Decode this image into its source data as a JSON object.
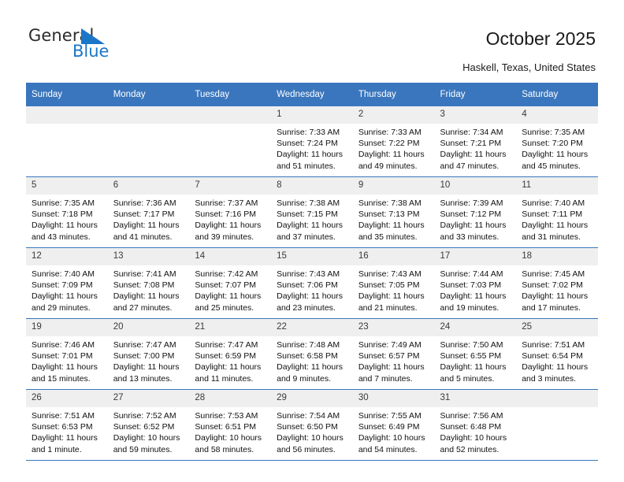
{
  "brand": {
    "name_top": "General",
    "name_bottom": "Blue",
    "triangle_color": "#1b76c8"
  },
  "header": {
    "title": "October 2025",
    "location": "Haskell, Texas, United States"
  },
  "theme": {
    "header_blue": "#3a76bd",
    "daynum_bg": "#efefef",
    "text": "#111111"
  },
  "calendar": {
    "weekday_headers": [
      "Sunday",
      "Monday",
      "Tuesday",
      "Wednesday",
      "Thursday",
      "Friday",
      "Saturday"
    ],
    "weeks": [
      [
        {
          "day": "",
          "lines": []
        },
        {
          "day": "",
          "lines": []
        },
        {
          "day": "",
          "lines": []
        },
        {
          "day": "1",
          "lines": [
            "Sunrise: 7:33 AM",
            "Sunset: 7:24 PM",
            "Daylight: 11 hours",
            "and 51 minutes."
          ]
        },
        {
          "day": "2",
          "lines": [
            "Sunrise: 7:33 AM",
            "Sunset: 7:22 PM",
            "Daylight: 11 hours",
            "and 49 minutes."
          ]
        },
        {
          "day": "3",
          "lines": [
            "Sunrise: 7:34 AM",
            "Sunset: 7:21 PM",
            "Daylight: 11 hours",
            "and 47 minutes."
          ]
        },
        {
          "day": "4",
          "lines": [
            "Sunrise: 7:35 AM",
            "Sunset: 7:20 PM",
            "Daylight: 11 hours",
            "and 45 minutes."
          ]
        }
      ],
      [
        {
          "day": "5",
          "lines": [
            "Sunrise: 7:35 AM",
            "Sunset: 7:18 PM",
            "Daylight: 11 hours",
            "and 43 minutes."
          ]
        },
        {
          "day": "6",
          "lines": [
            "Sunrise: 7:36 AM",
            "Sunset: 7:17 PM",
            "Daylight: 11 hours",
            "and 41 minutes."
          ]
        },
        {
          "day": "7",
          "lines": [
            "Sunrise: 7:37 AM",
            "Sunset: 7:16 PM",
            "Daylight: 11 hours",
            "and 39 minutes."
          ]
        },
        {
          "day": "8",
          "lines": [
            "Sunrise: 7:38 AM",
            "Sunset: 7:15 PM",
            "Daylight: 11 hours",
            "and 37 minutes."
          ]
        },
        {
          "day": "9",
          "lines": [
            "Sunrise: 7:38 AM",
            "Sunset: 7:13 PM",
            "Daylight: 11 hours",
            "and 35 minutes."
          ]
        },
        {
          "day": "10",
          "lines": [
            "Sunrise: 7:39 AM",
            "Sunset: 7:12 PM",
            "Daylight: 11 hours",
            "and 33 minutes."
          ]
        },
        {
          "day": "11",
          "lines": [
            "Sunrise: 7:40 AM",
            "Sunset: 7:11 PM",
            "Daylight: 11 hours",
            "and 31 minutes."
          ]
        }
      ],
      [
        {
          "day": "12",
          "lines": [
            "Sunrise: 7:40 AM",
            "Sunset: 7:09 PM",
            "Daylight: 11 hours",
            "and 29 minutes."
          ]
        },
        {
          "day": "13",
          "lines": [
            "Sunrise: 7:41 AM",
            "Sunset: 7:08 PM",
            "Daylight: 11 hours",
            "and 27 minutes."
          ]
        },
        {
          "day": "14",
          "lines": [
            "Sunrise: 7:42 AM",
            "Sunset: 7:07 PM",
            "Daylight: 11 hours",
            "and 25 minutes."
          ]
        },
        {
          "day": "15",
          "lines": [
            "Sunrise: 7:43 AM",
            "Sunset: 7:06 PM",
            "Daylight: 11 hours",
            "and 23 minutes."
          ]
        },
        {
          "day": "16",
          "lines": [
            "Sunrise: 7:43 AM",
            "Sunset: 7:05 PM",
            "Daylight: 11 hours",
            "and 21 minutes."
          ]
        },
        {
          "day": "17",
          "lines": [
            "Sunrise: 7:44 AM",
            "Sunset: 7:03 PM",
            "Daylight: 11 hours",
            "and 19 minutes."
          ]
        },
        {
          "day": "18",
          "lines": [
            "Sunrise: 7:45 AM",
            "Sunset: 7:02 PM",
            "Daylight: 11 hours",
            "and 17 minutes."
          ]
        }
      ],
      [
        {
          "day": "19",
          "lines": [
            "Sunrise: 7:46 AM",
            "Sunset: 7:01 PM",
            "Daylight: 11 hours",
            "and 15 minutes."
          ]
        },
        {
          "day": "20",
          "lines": [
            "Sunrise: 7:47 AM",
            "Sunset: 7:00 PM",
            "Daylight: 11 hours",
            "and 13 minutes."
          ]
        },
        {
          "day": "21",
          "lines": [
            "Sunrise: 7:47 AM",
            "Sunset: 6:59 PM",
            "Daylight: 11 hours",
            "and 11 minutes."
          ]
        },
        {
          "day": "22",
          "lines": [
            "Sunrise: 7:48 AM",
            "Sunset: 6:58 PM",
            "Daylight: 11 hours",
            "and 9 minutes."
          ]
        },
        {
          "day": "23",
          "lines": [
            "Sunrise: 7:49 AM",
            "Sunset: 6:57 PM",
            "Daylight: 11 hours",
            "and 7 minutes."
          ]
        },
        {
          "day": "24",
          "lines": [
            "Sunrise: 7:50 AM",
            "Sunset: 6:55 PM",
            "Daylight: 11 hours",
            "and 5 minutes."
          ]
        },
        {
          "day": "25",
          "lines": [
            "Sunrise: 7:51 AM",
            "Sunset: 6:54 PM",
            "Daylight: 11 hours",
            "and 3 minutes."
          ]
        }
      ],
      [
        {
          "day": "26",
          "lines": [
            "Sunrise: 7:51 AM",
            "Sunset: 6:53 PM",
            "Daylight: 11 hours",
            "and 1 minute."
          ]
        },
        {
          "day": "27",
          "lines": [
            "Sunrise: 7:52 AM",
            "Sunset: 6:52 PM",
            "Daylight: 10 hours",
            "and 59 minutes."
          ]
        },
        {
          "day": "28",
          "lines": [
            "Sunrise: 7:53 AM",
            "Sunset: 6:51 PM",
            "Daylight: 10 hours",
            "and 58 minutes."
          ]
        },
        {
          "day": "29",
          "lines": [
            "Sunrise: 7:54 AM",
            "Sunset: 6:50 PM",
            "Daylight: 10 hours",
            "and 56 minutes."
          ]
        },
        {
          "day": "30",
          "lines": [
            "Sunrise: 7:55 AM",
            "Sunset: 6:49 PM",
            "Daylight: 10 hours",
            "and 54 minutes."
          ]
        },
        {
          "day": "31",
          "lines": [
            "Sunrise: 7:56 AM",
            "Sunset: 6:48 PM",
            "Daylight: 10 hours",
            "and 52 minutes."
          ]
        },
        {
          "day": "",
          "lines": []
        }
      ]
    ]
  }
}
